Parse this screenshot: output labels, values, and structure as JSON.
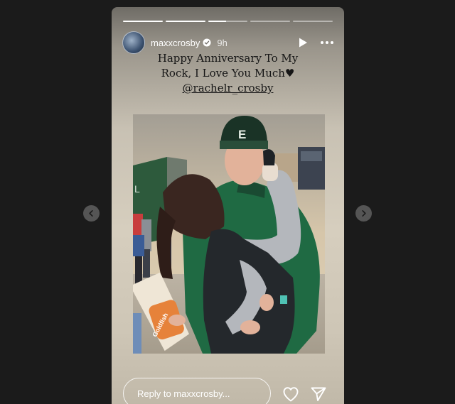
{
  "navigation": {
    "prev_icon": "chevron-left-icon",
    "next_icon": "chevron-right-icon"
  },
  "story": {
    "progress": [
      1.0,
      1.0,
      0.45,
      0.0,
      0.0
    ],
    "username": "maxxcrosby",
    "verified": true,
    "time": "9h",
    "caption": {
      "line1": "Happy Anniversary To My",
      "line2": "Rock, I Love You Much♥",
      "mention": "@rachelr_crosby"
    },
    "photo_text": {
      "hat_logo": "E",
      "bag_logo": "Goldfish"
    }
  },
  "reply_bar": {
    "placeholder": "Reply to maxxcrosby..."
  },
  "colors": {
    "background": "#1b1b1b",
    "text_dark": "#161616",
    "white": "#ffffff"
  }
}
